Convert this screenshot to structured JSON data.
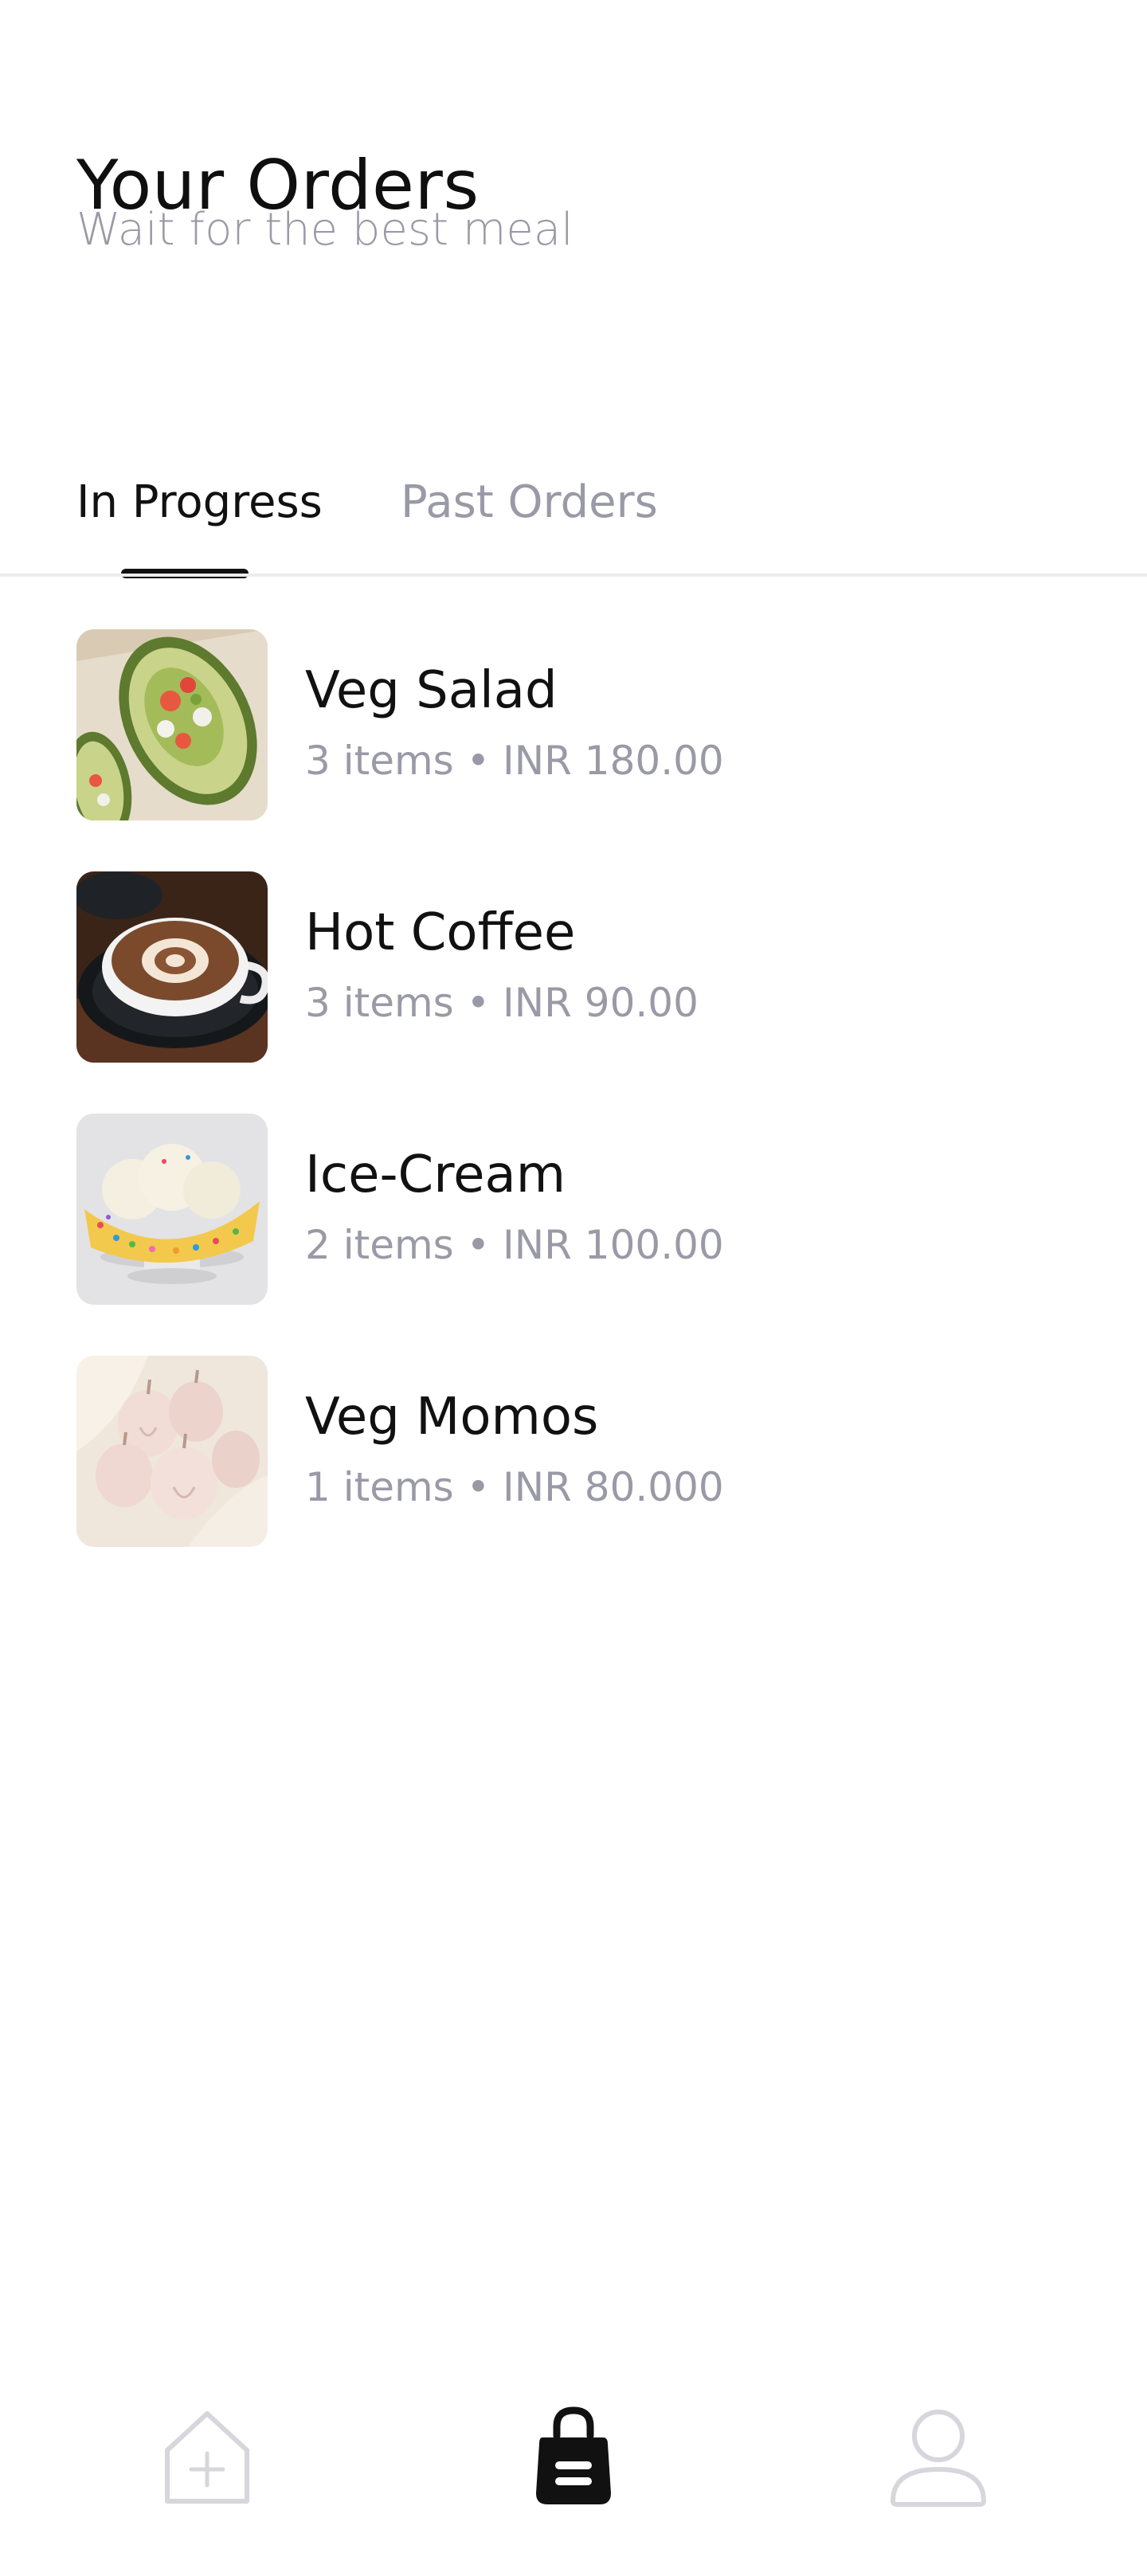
{
  "header": {
    "title": "Your Orders",
    "subtitle": "Wait for the best meal"
  },
  "tabs": [
    {
      "label": "In Progress",
      "active": true
    },
    {
      "label": "Past Orders",
      "active": false
    }
  ],
  "orders": [
    {
      "name": "Veg Salad",
      "meta": "3 items • INR 180.00",
      "image_icon": "salad-image"
    },
    {
      "name": "Hot Coffee",
      "meta": "3 items • INR 90.00",
      "image_icon": "coffee-image"
    },
    {
      "name": "Ice-Cream",
      "meta": "2 items • INR 100.00",
      "image_icon": "ice-cream-image"
    },
    {
      "name": "Veg Momos",
      "meta": "1 items • INR 80.000",
      "image_icon": "momos-image"
    }
  ],
  "bottom_nav": {
    "items": [
      {
        "icon": "home-plus-icon",
        "active": false
      },
      {
        "icon": "shopping-bag-icon",
        "active": true
      },
      {
        "icon": "profile-icon",
        "active": false
      }
    ]
  },
  "colors": {
    "primary_text": "#111111",
    "secondary_text": "#9a9aa7",
    "divider": "#ececf0",
    "inactive_icon": "#d6d6dc"
  }
}
